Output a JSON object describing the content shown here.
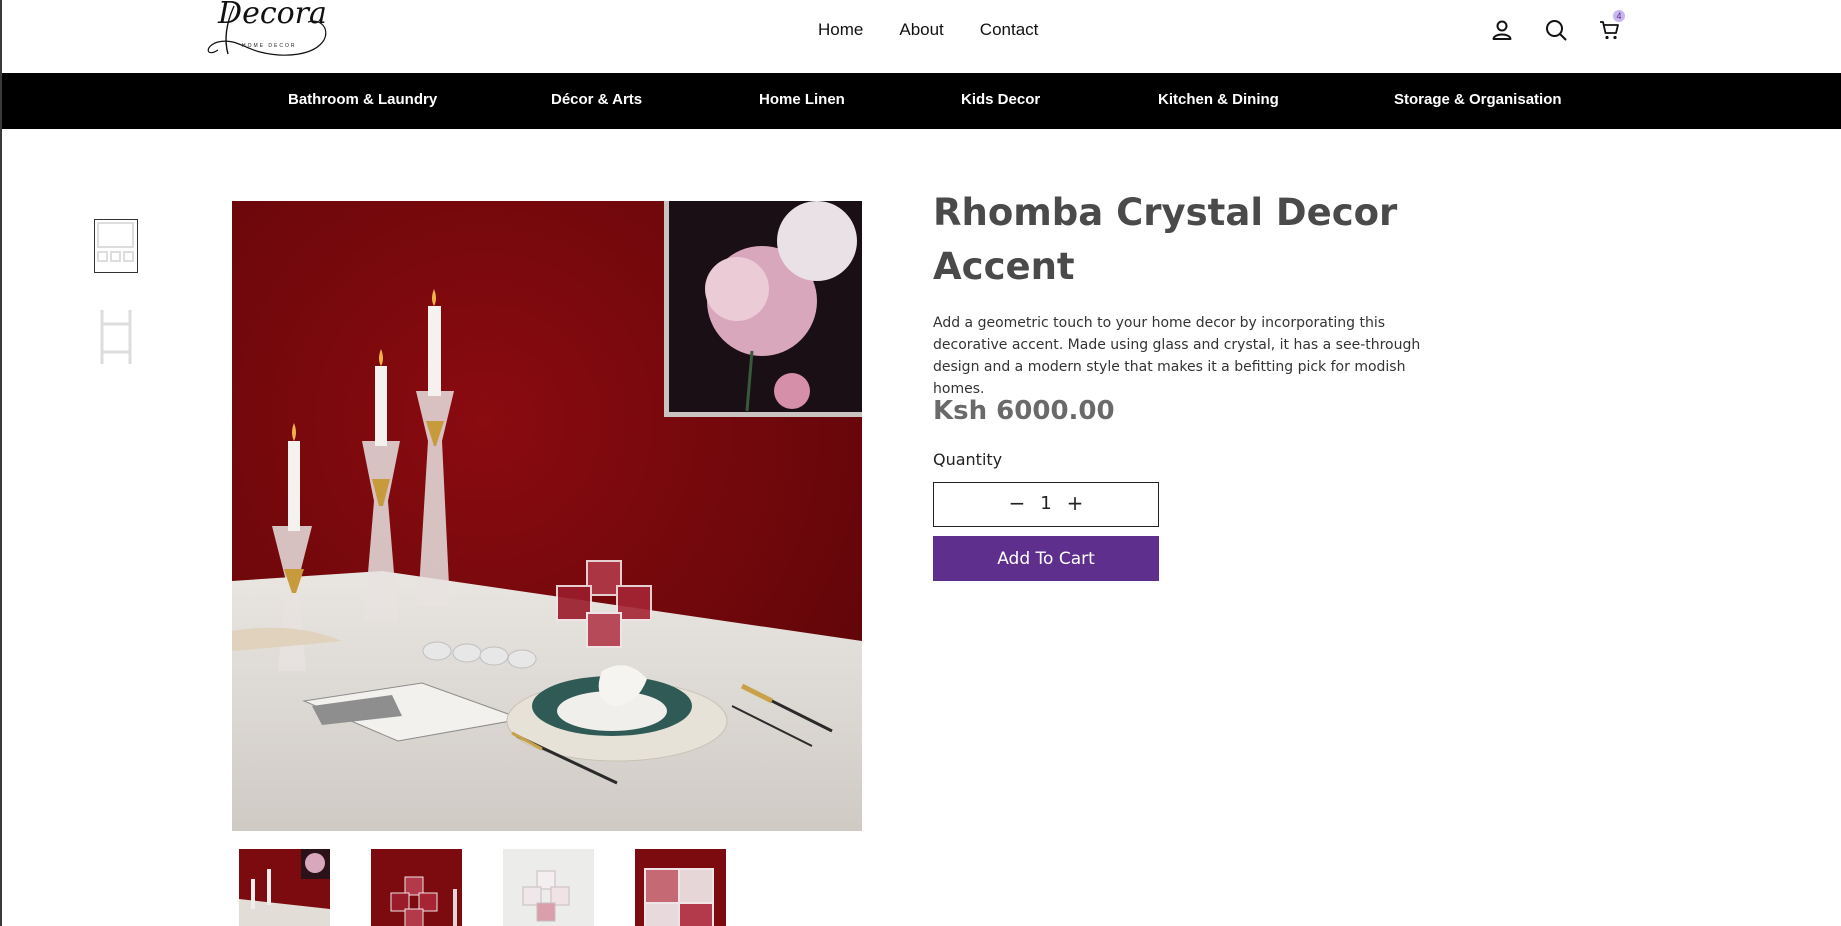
{
  "brand": {
    "logo_text": "ecora",
    "logo_initial": "D",
    "logo_sub": "HOME DECOR"
  },
  "topnav": [
    {
      "label": "Home"
    },
    {
      "label": "About"
    },
    {
      "label": "Contact"
    }
  ],
  "header_icons": {
    "account": "user-icon",
    "search": "search-icon",
    "cart": "cart-icon",
    "cart_count": "4"
  },
  "categories": [
    {
      "label": "Bathroom & Laundry"
    },
    {
      "label": "Décor & Arts"
    },
    {
      "label": "Home Linen"
    },
    {
      "label": "Kids Decor"
    },
    {
      "label": "Kitchen & Dining"
    },
    {
      "label": "Storage & Organisation"
    }
  ],
  "product": {
    "title": "Rhomba Crystal Decor Accent",
    "description": "Add a geometric touch to your home decor by incorporating this decorative accent. Made using glass and crystal, it has a see-through design and a modern style that makes it a befitting pick for modish homes.",
    "price": "Ksh 6000.00",
    "quantity_label": "Quantity",
    "quantity": "1",
    "minus": "−",
    "plus": "+",
    "add_to_cart": "Add To Cart"
  },
  "colors": {
    "category_bar": "#000000",
    "button": "#5e2f8c",
    "badge": "#c9b6ef",
    "backdrop": "#8a0b10"
  }
}
